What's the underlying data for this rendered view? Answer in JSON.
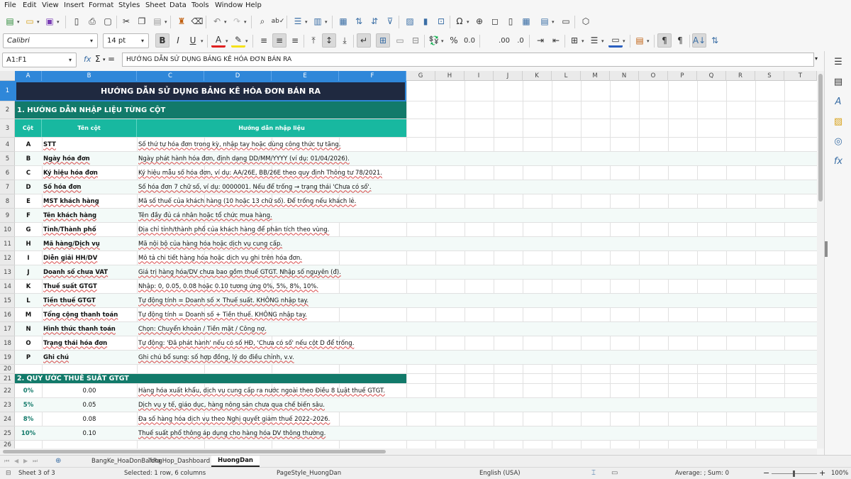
{
  "menu": [
    "File",
    "Edit",
    "View",
    "Insert",
    "Format",
    "Styles",
    "Sheet",
    "Data",
    "Tools",
    "Window",
    "Help"
  ],
  "toolbar": {
    "font_name": "Calibri",
    "font_size": "14 pt",
    "bold": "B",
    "italic": "I",
    "underline": "U",
    "font_color_glyph": "A",
    "percent": "%",
    "decimal_0": "0.0",
    "add_decimal": ".00",
    "del_decimal": ".0",
    "accent_colors": {
      "font": "#e02020",
      "highlight": "#f5e11a",
      "border": "#2a5fc0"
    }
  },
  "formula_bar": {
    "name_box": "A1:F1",
    "fx": "fx",
    "sigma": "Σ",
    "equals": "=",
    "content": "HƯỚNG DẪN SỬ DỤNG BẢNG KÊ HÓA ĐƠN BÁN RA"
  },
  "columns": [
    "A",
    "B",
    "C",
    "D",
    "E",
    "F",
    "G",
    "H",
    "I",
    "J",
    "K",
    "L",
    "M",
    "N",
    "O",
    "P",
    "Q",
    "R",
    "S",
    "T"
  ],
  "rows": [
    "1",
    "2",
    "3",
    "4",
    "5",
    "6",
    "7",
    "8",
    "9",
    "10",
    "11",
    "12",
    "13",
    "14",
    "15",
    "16",
    "17",
    "18",
    "19",
    "20",
    "21",
    "22",
    "23",
    "24",
    "25",
    "26"
  ],
  "sheet": {
    "title": "HƯỚNG DẪN SỬ DỤNG BẢNG KÊ HÓA ĐƠN BÁN RA",
    "section1": "1. HƯỚNG DẪN NHẬP LIỆU TỪNG CỘT",
    "header": {
      "col": "Cột",
      "name": "Tên cột",
      "guide": "Hướng dẫn nhập liệu"
    },
    "items": [
      {
        "col": "A",
        "name": "STT",
        "guide": "Số thứ tự hóa đơn trong kỳ, nhập tay hoặc dùng công thức tự tăng."
      },
      {
        "col": "B",
        "name": "Ngày hóa đơn",
        "guide": "Ngày phát hành hóa đơn, định dạng DD/MM/YYYY (ví dụ: 01/04/2026)."
      },
      {
        "col": "C",
        "name": "Ký hiệu hóa đơn",
        "guide": "Ký hiệu mẫu số hóa đơn, ví dụ: AA/26E, BB/26E theo quy định Thông tư 78/2021."
      },
      {
        "col": "D",
        "name": "Số hóa đơn",
        "guide": "Số hóa đơn 7 chữ số, ví dụ: 0000001. Nếu để trống → trạng thái 'Chưa có số'."
      },
      {
        "col": "E",
        "name": "MST khách hàng",
        "guide": "Mã số thuế của khách hàng (10 hoặc 13 chữ số). Để trống nếu khách lẻ."
      },
      {
        "col": "F",
        "name": "Tên khách hàng",
        "guide": "Tên đầy đủ cá nhân hoặc tổ chức mua hàng."
      },
      {
        "col": "G",
        "name": "Tỉnh/Thành phố",
        "guide": "Địa chỉ tỉnh/thành phố của khách hàng để phân tích theo vùng."
      },
      {
        "col": "H",
        "name": "Mã hàng/Dịch vụ",
        "guide": "Mã nội bộ của hàng hóa hoặc dịch vụ cung cấp."
      },
      {
        "col": "I",
        "name": "Diễn giải HH/DV",
        "guide": "Mô tả chi tiết hàng hóa hoặc dịch vụ ghi trên hóa đơn."
      },
      {
        "col": "J",
        "name": "Doanh số chưa VAT",
        "guide": "Giá trị hàng hóa/DV chưa bao gồm thuế GTGT. Nhập số nguyên (đ)."
      },
      {
        "col": "K",
        "name": "Thuế suất GTGT",
        "guide": "Nhập: 0, 0.05, 0.08 hoặc 0.10 tương ứng 0%, 5%, 8%, 10%."
      },
      {
        "col": "L",
        "name": "Tiền thuế GTGT",
        "guide": "Tự động tính = Doanh số × Thuế suất. KHÔNG nhập tay."
      },
      {
        "col": "M",
        "name": "Tổng cộng thanh toán",
        "guide": "Tự động tính = Doanh số + Tiền thuế. KHÔNG nhập tay."
      },
      {
        "col": "N",
        "name": "Hình thức thanh toán",
        "guide": "Chọn: Chuyển khoản / Tiền mặt / Công nợ."
      },
      {
        "col": "O",
        "name": "Trạng thái hóa đơn",
        "guide": "Tự động: 'Đã phát hành' nếu có số HĐ, 'Chưa có số' nếu cột D để trống."
      },
      {
        "col": "P",
        "name": "Ghi chú",
        "guide": "Ghi chú bổ sung: số hợp đồng, lý do điều chỉnh, v.v."
      }
    ],
    "section2": "2. QUY ƯỚC THUẾ SUẤT GTGT",
    "rates": [
      {
        "pct": "0%",
        "val": "0.00",
        "desc": "Hàng hóa xuất khẩu, dịch vụ cung cấp ra nước ngoài theo Điều 8 Luật thuế GTGT."
      },
      {
        "pct": "5%",
        "val": "0.05",
        "desc": "Dịch vụ y tế, giáo dục, hàng nông sản chưa qua chế biến sâu."
      },
      {
        "pct": "8%",
        "val": "0.08",
        "desc": "Đa số hàng hóa dịch vụ theo Nghị quyết giảm thuế 2022–2026."
      },
      {
        "pct": "10%",
        "val": "0.10",
        "desc": "Thuế suất phổ thông áp dụng cho hàng hóa DV thông thường."
      }
    ],
    "colors": {
      "title_bg": "#1f2940",
      "section_bg": "#127a6a",
      "header_bg": "#18b8a0",
      "rate_color": "#127a6a"
    }
  },
  "tabs": [
    "BangKe_HoaDonBanRa",
    "TongHop_Dashboard",
    "HuongDan"
  ],
  "active_tab": "HuongDan",
  "status": {
    "sheet": "Sheet 3 of 3",
    "selection": "Selected: 1 row, 6 columns",
    "page_style": "PageStyle_HuongDan",
    "language": "English (USA)",
    "sum": "Average: ; Sum: 0",
    "zoom": "100%"
  }
}
